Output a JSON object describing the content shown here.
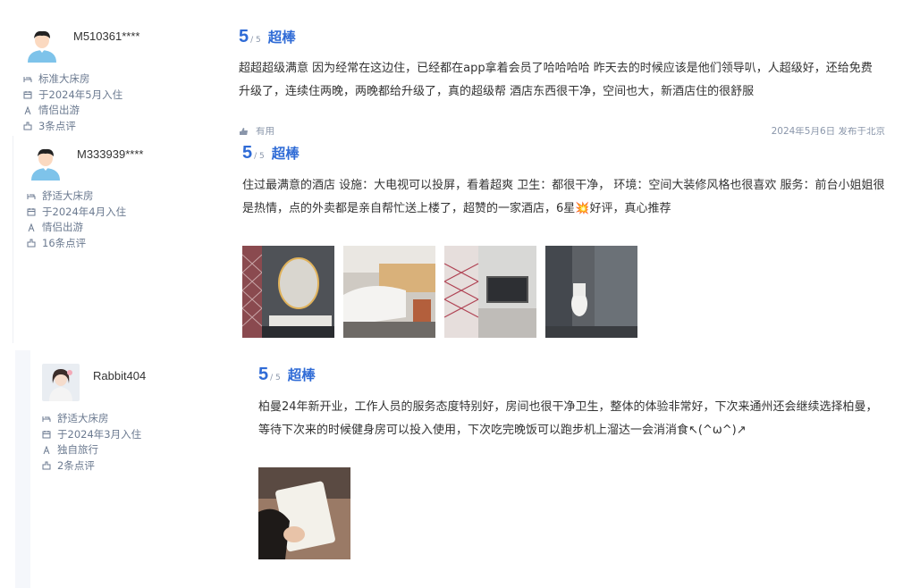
{
  "reviews": [
    {
      "username": "M510361****",
      "room": "标准大床房",
      "stay": "于2024年5月入住",
      "trip": "情侣出游",
      "count": "3条点评",
      "score": "5",
      "score_max": "/ 5",
      "score_word": "超棒",
      "text": "超超超级满意 因为经常在这边住，已经都在app拿着会员了哈哈哈哈 昨天去的时候应该是他们领导叭，人超级好，还给免费升级了，连续住两晚，两晚都给升级了，真的超级帮 酒店东西很干净，空间也大，新酒店住的很舒服",
      "useful": "有用",
      "date": "2024年5月6日 发布于北京"
    },
    {
      "username": "M333939****",
      "room": "舒适大床房",
      "stay": "于2024年4月入住",
      "trip": "情侣出游",
      "count": "16条点评",
      "score": "5",
      "score_max": "/ 5",
      "score_word": "超棒",
      "text": "住过最满意的酒店 设施：大电视可以投屏，看着超爽 卫生：都很干净， 环境：空间大装修风格也很喜欢 服务：前台小姐姐很是热情，点的外卖都是亲自帮忙送上楼了，超赞的一家酒店，6星💥好评，真心推荐"
    },
    {
      "username": "Rabbit404",
      "room": "舒适大床房",
      "stay": "于2024年3月入住",
      "trip": "独自旅行",
      "count": "2条点评",
      "score": "5",
      "score_max": "/ 5",
      "score_word": "超棒",
      "text": "柏曼24年新开业，工作人员的服务态度特别好，房间也很干净卫生，整体的体验非常好，下次来通州还会继续选择柏曼，等待下次来的时候健身房可以投入使用，下次吃完晚饭可以跑步机上溜达一会消消食↖(^ω^)↗"
    }
  ],
  "colors": {
    "accent": "#2f6bd6",
    "meta": "#6b7a90",
    "panel": "#f5f7fb"
  },
  "icons": [
    "bed-icon",
    "calendar-icon",
    "trip-icon",
    "review-count-icon",
    "thumb-up-icon"
  ]
}
